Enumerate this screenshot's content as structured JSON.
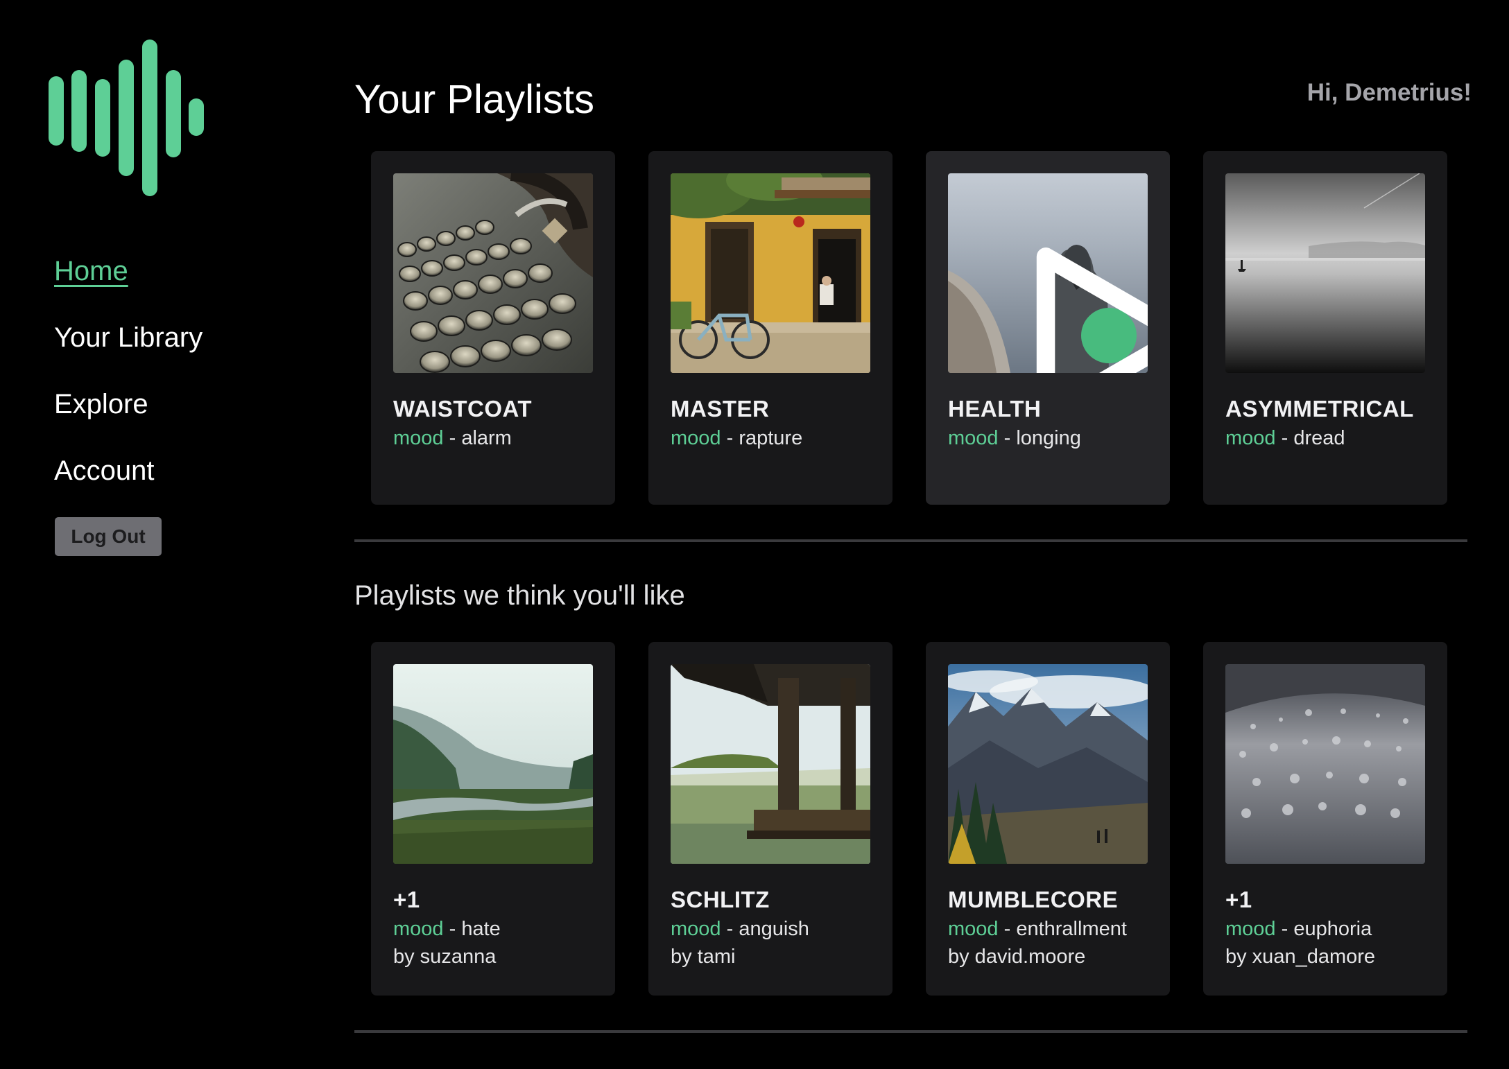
{
  "brand": {
    "logo_icon": "sound-wave-icon",
    "accent_color": "#5ecf96"
  },
  "nav": {
    "items": [
      {
        "label": "Home",
        "active": true
      },
      {
        "label": "Your Library",
        "active": false
      },
      {
        "label": "Explore",
        "active": false
      },
      {
        "label": "Account",
        "active": false
      }
    ],
    "logout_label": "Log Out"
  },
  "header": {
    "title": "Your Playlists",
    "greeting": "Hi, Demetrius!"
  },
  "your_playlists": [
    {
      "name": "WAISTCOAT",
      "mood_key": "mood",
      "mood": "alarm",
      "cover": "typewriter photo"
    },
    {
      "name": "MASTER",
      "mood_key": "mood",
      "mood": "rapture",
      "cover": "yellow house with bicycle photo"
    },
    {
      "name": "HEALTH",
      "mood_key": "mood",
      "mood": "longing",
      "cover": "hooded person by the sea photo",
      "play_icon": "play-icon"
    },
    {
      "name": "ASYMMETRICAL",
      "mood_key": "mood",
      "mood": "dread",
      "cover": "misty black and white sea photo"
    }
  ],
  "recommended": {
    "title": "Playlists we think you'll like",
    "items": [
      {
        "name": "+1",
        "mood_key": "mood",
        "mood": "hate",
        "author": "by suzanna",
        "cover": "misty river valley photo"
      },
      {
        "name": "SCHLITZ",
        "mood_key": "mood",
        "mood": "anguish",
        "author": "by tami",
        "cover": "dock over misty lake photo"
      },
      {
        "name": "MUMBLECORE",
        "mood_key": "mood",
        "mood": "enthrallment",
        "author": "by david.moore",
        "cover": "mountain range with hikers photo"
      },
      {
        "name": "+1",
        "mood_key": "mood",
        "mood": "euphoria",
        "author": "by xuan_damore",
        "cover": "water droplets on surface photo"
      }
    ]
  }
}
